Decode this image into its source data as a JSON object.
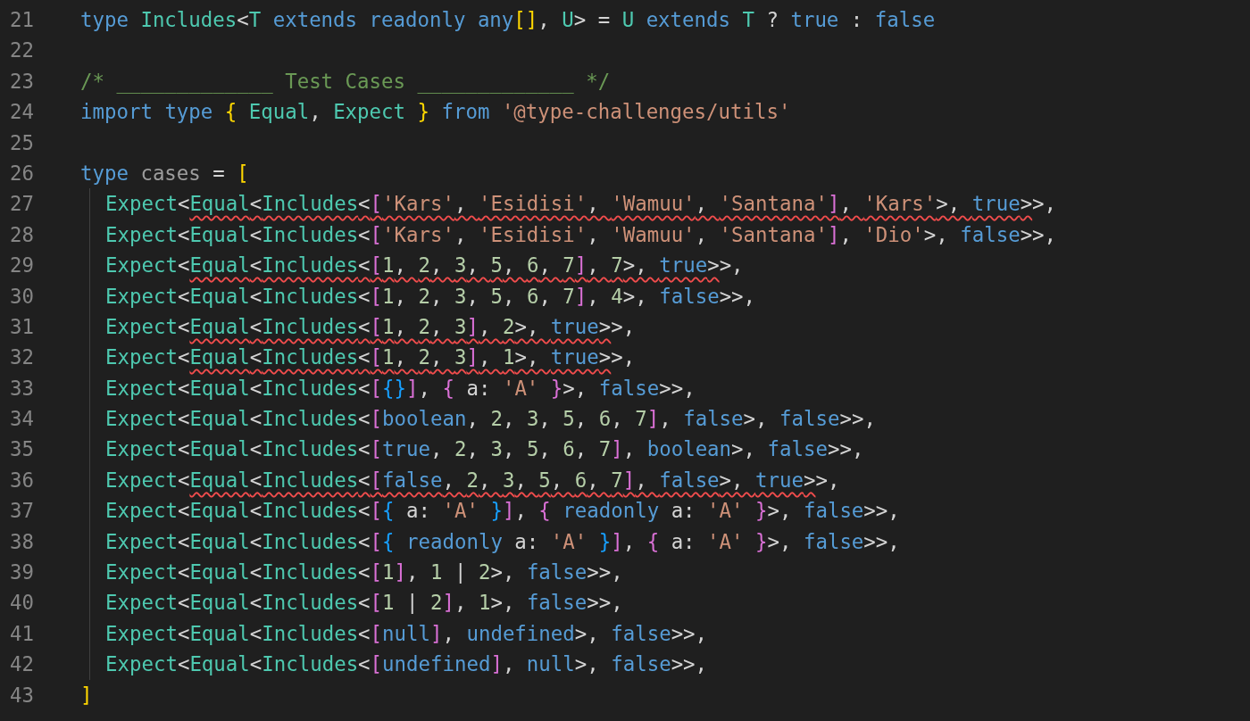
{
  "lines": [
    {
      "number": "21",
      "indented": false,
      "segments": [
        {
          "error": false,
          "tokens": [
            {
              "text": "type ",
              "kind": "keyword"
            },
            {
              "text": "Includes",
              "kind": "type"
            },
            {
              "text": "<",
              "kind": "punct"
            },
            {
              "text": "T ",
              "kind": "type"
            },
            {
              "text": "extends ",
              "kind": "keyword"
            },
            {
              "text": "readonly ",
              "kind": "keyword"
            },
            {
              "text": "any",
              "kind": "keyword"
            },
            {
              "text": "[]",
              "kind": "bracket1"
            },
            {
              "text": ", ",
              "kind": "punct"
            },
            {
              "text": "U",
              "kind": "type"
            },
            {
              "text": "> = ",
              "kind": "punct"
            },
            {
              "text": "U ",
              "kind": "type"
            },
            {
              "text": "extends ",
              "kind": "keyword"
            },
            {
              "text": "T",
              "kind": "type"
            },
            {
              "text": " ? ",
              "kind": "punct"
            },
            {
              "text": "true",
              "kind": "keyword"
            },
            {
              "text": " : ",
              "kind": "punct"
            },
            {
              "text": "false",
              "kind": "keyword"
            }
          ]
        }
      ]
    },
    {
      "number": "22",
      "indented": false
    },
    {
      "number": "23",
      "indented": false,
      "segments": [
        {
          "error": false,
          "tokens": [
            {
              "text": "/* _____________ Test Cases _____________ */",
              "kind": "comment"
            }
          ]
        }
      ]
    },
    {
      "number": "24",
      "indented": false,
      "segments": [
        {
          "error": false,
          "tokens": [
            {
              "text": "import ",
              "kind": "keyword"
            },
            {
              "text": "type ",
              "kind": "keyword"
            },
            {
              "text": "{ ",
              "kind": "bracket1"
            },
            {
              "text": "Equal",
              "kind": "type"
            },
            {
              "text": ", ",
              "kind": "punct"
            },
            {
              "text": "Expect ",
              "kind": "type"
            },
            {
              "text": "} ",
              "kind": "bracket1"
            },
            {
              "text": "from ",
              "kind": "keyword"
            },
            {
              "text": "'@type-challenges/utils'",
              "kind": "string"
            }
          ]
        }
      ]
    },
    {
      "number": "25",
      "indented": false
    },
    {
      "number": "26",
      "indented": false,
      "segments": [
        {
          "error": false,
          "tokens": [
            {
              "text": "type ",
              "kind": "keyword"
            },
            {
              "text": "cases",
              "kind": "variable"
            },
            {
              "text": " = ",
              "kind": "punct"
            },
            {
              "text": "[",
              "kind": "bracket1"
            }
          ]
        }
      ]
    },
    {
      "number": "27",
      "indented": true,
      "segments": [
        {
          "error": false,
          "tokens": [
            {
              "text": "Expect",
              "kind": "type"
            },
            {
              "text": "<",
              "kind": "punct"
            }
          ]
        },
        {
          "error": true,
          "tokens": [
            {
              "text": "Equal",
              "kind": "type"
            },
            {
              "text": "<",
              "kind": "punct"
            },
            {
              "text": "Includes",
              "kind": "type"
            },
            {
              "text": "<",
              "kind": "punct"
            },
            {
              "text": "[",
              "kind": "bracket2"
            },
            {
              "text": "'Kars'",
              "kind": "string"
            },
            {
              "text": ", ",
              "kind": "punct"
            },
            {
              "text": "'Esidisi'",
              "kind": "string"
            },
            {
              "text": ", ",
              "kind": "punct"
            },
            {
              "text": "'Wamuu'",
              "kind": "string"
            },
            {
              "text": ", ",
              "kind": "punct"
            },
            {
              "text": "'Santana'",
              "kind": "string"
            },
            {
              "text": "]",
              "kind": "bracket2"
            },
            {
              "text": ", ",
              "kind": "punct"
            },
            {
              "text": "'Kars'",
              "kind": "string"
            },
            {
              "text": ">, ",
              "kind": "punct"
            },
            {
              "text": "true",
              "kind": "keyword"
            },
            {
              "text": ">",
              "kind": "punct"
            }
          ]
        },
        {
          "error": false,
          "tokens": [
            {
              "text": ">,",
              "kind": "punct"
            }
          ]
        }
      ]
    },
    {
      "number": "28",
      "indented": true,
      "segments": [
        {
          "error": false,
          "tokens": [
            {
              "text": "Expect",
              "kind": "type"
            },
            {
              "text": "<",
              "kind": "punct"
            },
            {
              "text": "Equal",
              "kind": "type"
            },
            {
              "text": "<",
              "kind": "punct"
            },
            {
              "text": "Includes",
              "kind": "type"
            },
            {
              "text": "<",
              "kind": "punct"
            },
            {
              "text": "[",
              "kind": "bracket2"
            },
            {
              "text": "'Kars'",
              "kind": "string"
            },
            {
              "text": ", ",
              "kind": "punct"
            },
            {
              "text": "'Esidisi'",
              "kind": "string"
            },
            {
              "text": ", ",
              "kind": "punct"
            },
            {
              "text": "'Wamuu'",
              "kind": "string"
            },
            {
              "text": ", ",
              "kind": "punct"
            },
            {
              "text": "'Santana'",
              "kind": "string"
            },
            {
              "text": "]",
              "kind": "bracket2"
            },
            {
              "text": ", ",
              "kind": "punct"
            },
            {
              "text": "'Dio'",
              "kind": "string"
            },
            {
              "text": ">, ",
              "kind": "punct"
            },
            {
              "text": "false",
              "kind": "keyword"
            },
            {
              "text": ">>,",
              "kind": "punct"
            }
          ]
        }
      ]
    },
    {
      "number": "29",
      "indented": true,
      "segments": [
        {
          "error": false,
          "tokens": [
            {
              "text": "Expect",
              "kind": "type"
            },
            {
              "text": "<",
              "kind": "punct"
            }
          ]
        },
        {
          "error": true,
          "tokens": [
            {
              "text": "Equal",
              "kind": "type"
            },
            {
              "text": "<",
              "kind": "punct"
            },
            {
              "text": "Includes",
              "kind": "type"
            },
            {
              "text": "<",
              "kind": "punct"
            },
            {
              "text": "[",
              "kind": "bracket2"
            },
            {
              "text": "1",
              "kind": "number"
            },
            {
              "text": ", ",
              "kind": "punct"
            },
            {
              "text": "2",
              "kind": "number"
            },
            {
              "text": ", ",
              "kind": "punct"
            },
            {
              "text": "3",
              "kind": "number"
            },
            {
              "text": ", ",
              "kind": "punct"
            },
            {
              "text": "5",
              "kind": "number"
            },
            {
              "text": ", ",
              "kind": "punct"
            },
            {
              "text": "6",
              "kind": "number"
            },
            {
              "text": ", ",
              "kind": "punct"
            },
            {
              "text": "7",
              "kind": "number"
            },
            {
              "text": "]",
              "kind": "bracket2"
            },
            {
              "text": ", ",
              "kind": "punct"
            },
            {
              "text": "7",
              "kind": "number"
            },
            {
              "text": ">, ",
              "kind": "punct"
            },
            {
              "text": "true",
              "kind": "keyword"
            },
            {
              "text": ">",
              "kind": "punct"
            }
          ]
        },
        {
          "error": false,
          "tokens": [
            {
              "text": ">,",
              "kind": "punct"
            }
          ]
        }
      ]
    },
    {
      "number": "30",
      "indented": true,
      "segments": [
        {
          "error": false,
          "tokens": [
            {
              "text": "Expect",
              "kind": "type"
            },
            {
              "text": "<",
              "kind": "punct"
            },
            {
              "text": "Equal",
              "kind": "type"
            },
            {
              "text": "<",
              "kind": "punct"
            },
            {
              "text": "Includes",
              "kind": "type"
            },
            {
              "text": "<",
              "kind": "punct"
            },
            {
              "text": "[",
              "kind": "bracket2"
            },
            {
              "text": "1",
              "kind": "number"
            },
            {
              "text": ", ",
              "kind": "punct"
            },
            {
              "text": "2",
              "kind": "number"
            },
            {
              "text": ", ",
              "kind": "punct"
            },
            {
              "text": "3",
              "kind": "number"
            },
            {
              "text": ", ",
              "kind": "punct"
            },
            {
              "text": "5",
              "kind": "number"
            },
            {
              "text": ", ",
              "kind": "punct"
            },
            {
              "text": "6",
              "kind": "number"
            },
            {
              "text": ", ",
              "kind": "punct"
            },
            {
              "text": "7",
              "kind": "number"
            },
            {
              "text": "]",
              "kind": "bracket2"
            },
            {
              "text": ", ",
              "kind": "punct"
            },
            {
              "text": "4",
              "kind": "number"
            },
            {
              "text": ">, ",
              "kind": "punct"
            },
            {
              "text": "false",
              "kind": "keyword"
            },
            {
              "text": ">>,",
              "kind": "punct"
            }
          ]
        }
      ]
    },
    {
      "number": "31",
      "indented": true,
      "segments": [
        {
          "error": false,
          "tokens": [
            {
              "text": "Expect",
              "kind": "type"
            },
            {
              "text": "<",
              "kind": "punct"
            }
          ]
        },
        {
          "error": true,
          "tokens": [
            {
              "text": "Equal",
              "kind": "type"
            },
            {
              "text": "<",
              "kind": "punct"
            },
            {
              "text": "Includes",
              "kind": "type"
            },
            {
              "text": "<",
              "kind": "punct"
            },
            {
              "text": "[",
              "kind": "bracket2"
            },
            {
              "text": "1",
              "kind": "number"
            },
            {
              "text": ", ",
              "kind": "punct"
            },
            {
              "text": "2",
              "kind": "number"
            },
            {
              "text": ", ",
              "kind": "punct"
            },
            {
              "text": "3",
              "kind": "number"
            },
            {
              "text": "]",
              "kind": "bracket2"
            },
            {
              "text": ", ",
              "kind": "punct"
            },
            {
              "text": "2",
              "kind": "number"
            },
            {
              "text": ">, ",
              "kind": "punct"
            },
            {
              "text": "true",
              "kind": "keyword"
            },
            {
              "text": ">",
              "kind": "punct"
            }
          ]
        },
        {
          "error": false,
          "tokens": [
            {
              "text": ">,",
              "kind": "punct"
            }
          ]
        }
      ]
    },
    {
      "number": "32",
      "indented": true,
      "segments": [
        {
          "error": false,
          "tokens": [
            {
              "text": "Expect",
              "kind": "type"
            },
            {
              "text": "<",
              "kind": "punct"
            }
          ]
        },
        {
          "error": true,
          "tokens": [
            {
              "text": "Equal",
              "kind": "type"
            },
            {
              "text": "<",
              "kind": "punct"
            },
            {
              "text": "Includes",
              "kind": "type"
            },
            {
              "text": "<",
              "kind": "punct"
            },
            {
              "text": "[",
              "kind": "bracket2"
            },
            {
              "text": "1",
              "kind": "number"
            },
            {
              "text": ", ",
              "kind": "punct"
            },
            {
              "text": "2",
              "kind": "number"
            },
            {
              "text": ", ",
              "kind": "punct"
            },
            {
              "text": "3",
              "kind": "number"
            },
            {
              "text": "]",
              "kind": "bracket2"
            },
            {
              "text": ", ",
              "kind": "punct"
            },
            {
              "text": "1",
              "kind": "number"
            },
            {
              "text": ">, ",
              "kind": "punct"
            },
            {
              "text": "true",
              "kind": "keyword"
            },
            {
              "text": ">",
              "kind": "punct"
            }
          ]
        },
        {
          "error": false,
          "tokens": [
            {
              "text": ">,",
              "kind": "punct"
            }
          ]
        }
      ]
    },
    {
      "number": "33",
      "indented": true,
      "segments": [
        {
          "error": false,
          "tokens": [
            {
              "text": "Expect",
              "kind": "type"
            },
            {
              "text": "<",
              "kind": "punct"
            },
            {
              "text": "Equal",
              "kind": "type"
            },
            {
              "text": "<",
              "kind": "punct"
            },
            {
              "text": "Includes",
              "kind": "type"
            },
            {
              "text": "<",
              "kind": "punct"
            },
            {
              "text": "[",
              "kind": "bracket2"
            },
            {
              "text": "{}",
              "kind": "bracket3"
            },
            {
              "text": "]",
              "kind": "bracket2"
            },
            {
              "text": ", ",
              "kind": "punct"
            },
            {
              "text": "{",
              "kind": "bracket2"
            },
            {
              "text": " a: ",
              "kind": "punct"
            },
            {
              "text": "'A' ",
              "kind": "string"
            },
            {
              "text": "}",
              "kind": "bracket2"
            },
            {
              "text": ">, ",
              "kind": "punct"
            },
            {
              "text": "false",
              "kind": "keyword"
            },
            {
              "text": ">>,",
              "kind": "punct"
            }
          ]
        }
      ]
    },
    {
      "number": "34",
      "indented": true,
      "segments": [
        {
          "error": false,
          "tokens": [
            {
              "text": "Expect",
              "kind": "type"
            },
            {
              "text": "<",
              "kind": "punct"
            },
            {
              "text": "Equal",
              "kind": "type"
            },
            {
              "text": "<",
              "kind": "punct"
            },
            {
              "text": "Includes",
              "kind": "type"
            },
            {
              "text": "<",
              "kind": "punct"
            },
            {
              "text": "[",
              "kind": "bracket2"
            },
            {
              "text": "boolean",
              "kind": "keyword"
            },
            {
              "text": ", ",
              "kind": "punct"
            },
            {
              "text": "2",
              "kind": "number"
            },
            {
              "text": ", ",
              "kind": "punct"
            },
            {
              "text": "3",
              "kind": "number"
            },
            {
              "text": ", ",
              "kind": "punct"
            },
            {
              "text": "5",
              "kind": "number"
            },
            {
              "text": ", ",
              "kind": "punct"
            },
            {
              "text": "6",
              "kind": "number"
            },
            {
              "text": ", ",
              "kind": "punct"
            },
            {
              "text": "7",
              "kind": "number"
            },
            {
              "text": "]",
              "kind": "bracket2"
            },
            {
              "text": ", ",
              "kind": "punct"
            },
            {
              "text": "false",
              "kind": "keyword"
            },
            {
              "text": ">, ",
              "kind": "punct"
            },
            {
              "text": "false",
              "kind": "keyword"
            },
            {
              "text": ">>,",
              "kind": "punct"
            }
          ]
        }
      ]
    },
    {
      "number": "35",
      "indented": true,
      "segments": [
        {
          "error": false,
          "tokens": [
            {
              "text": "Expect",
              "kind": "type"
            },
            {
              "text": "<",
              "kind": "punct"
            },
            {
              "text": "Equal",
              "kind": "type"
            },
            {
              "text": "<",
              "kind": "punct"
            },
            {
              "text": "Includes",
              "kind": "type"
            },
            {
              "text": "<",
              "kind": "punct"
            },
            {
              "text": "[",
              "kind": "bracket2"
            },
            {
              "text": "true",
              "kind": "keyword"
            },
            {
              "text": ", ",
              "kind": "punct"
            },
            {
              "text": "2",
              "kind": "number"
            },
            {
              "text": ", ",
              "kind": "punct"
            },
            {
              "text": "3",
              "kind": "number"
            },
            {
              "text": ", ",
              "kind": "punct"
            },
            {
              "text": "5",
              "kind": "number"
            },
            {
              "text": ", ",
              "kind": "punct"
            },
            {
              "text": "6",
              "kind": "number"
            },
            {
              "text": ", ",
              "kind": "punct"
            },
            {
              "text": "7",
              "kind": "number"
            },
            {
              "text": "]",
              "kind": "bracket2"
            },
            {
              "text": ", ",
              "kind": "punct"
            },
            {
              "text": "boolean",
              "kind": "keyword"
            },
            {
              "text": ">, ",
              "kind": "punct"
            },
            {
              "text": "false",
              "kind": "keyword"
            },
            {
              "text": ">>,",
              "kind": "punct"
            }
          ]
        }
      ]
    },
    {
      "number": "36",
      "indented": true,
      "segments": [
        {
          "error": false,
          "tokens": [
            {
              "text": "Expect",
              "kind": "type"
            },
            {
              "text": "<",
              "kind": "punct"
            }
          ]
        },
        {
          "error": true,
          "tokens": [
            {
              "text": "Equal",
              "kind": "type"
            },
            {
              "text": "<",
              "kind": "punct"
            },
            {
              "text": "Includes",
              "kind": "type"
            },
            {
              "text": "<",
              "kind": "punct"
            },
            {
              "text": "[",
              "kind": "bracket2"
            },
            {
              "text": "false",
              "kind": "keyword"
            },
            {
              "text": ", ",
              "kind": "punct"
            },
            {
              "text": "2",
              "kind": "number"
            },
            {
              "text": ", ",
              "kind": "punct"
            },
            {
              "text": "3",
              "kind": "number"
            },
            {
              "text": ", ",
              "kind": "punct"
            },
            {
              "text": "5",
              "kind": "number"
            },
            {
              "text": ", ",
              "kind": "punct"
            },
            {
              "text": "6",
              "kind": "number"
            },
            {
              "text": ", ",
              "kind": "punct"
            },
            {
              "text": "7",
              "kind": "number"
            },
            {
              "text": "]",
              "kind": "bracket2"
            },
            {
              "text": ", ",
              "kind": "punct"
            },
            {
              "text": "false",
              "kind": "keyword"
            },
            {
              "text": ">, ",
              "kind": "punct"
            },
            {
              "text": "true",
              "kind": "keyword"
            },
            {
              "text": ">",
              "kind": "punct"
            }
          ]
        },
        {
          "error": false,
          "tokens": [
            {
              "text": ">,",
              "kind": "punct"
            }
          ]
        }
      ]
    },
    {
      "number": "37",
      "indented": true,
      "segments": [
        {
          "error": false,
          "tokens": [
            {
              "text": "Expect",
              "kind": "type"
            },
            {
              "text": "<",
              "kind": "punct"
            },
            {
              "text": "Equal",
              "kind": "type"
            },
            {
              "text": "<",
              "kind": "punct"
            },
            {
              "text": "Includes",
              "kind": "type"
            },
            {
              "text": "<",
              "kind": "punct"
            },
            {
              "text": "[",
              "kind": "bracket2"
            },
            {
              "text": "{",
              "kind": "bracket3"
            },
            {
              "text": " a: ",
              "kind": "punct"
            },
            {
              "text": "'A' ",
              "kind": "string"
            },
            {
              "text": "}",
              "kind": "bracket3"
            },
            {
              "text": "]",
              "kind": "bracket2"
            },
            {
              "text": ", ",
              "kind": "punct"
            },
            {
              "text": "{ ",
              "kind": "bracket2"
            },
            {
              "text": "readonly",
              "kind": "keyword"
            },
            {
              "text": " a: ",
              "kind": "punct"
            },
            {
              "text": "'A' ",
              "kind": "string"
            },
            {
              "text": "}",
              "kind": "bracket2"
            },
            {
              "text": ">, ",
              "kind": "punct"
            },
            {
              "text": "false",
              "kind": "keyword"
            },
            {
              "text": ">>,",
              "kind": "punct"
            }
          ]
        }
      ]
    },
    {
      "number": "38",
      "indented": true,
      "segments": [
        {
          "error": false,
          "tokens": [
            {
              "text": "Expect",
              "kind": "type"
            },
            {
              "text": "<",
              "kind": "punct"
            },
            {
              "text": "Equal",
              "kind": "type"
            },
            {
              "text": "<",
              "kind": "punct"
            },
            {
              "text": "Includes",
              "kind": "type"
            },
            {
              "text": "<",
              "kind": "punct"
            },
            {
              "text": "[",
              "kind": "bracket2"
            },
            {
              "text": "{ ",
              "kind": "bracket3"
            },
            {
              "text": "readonly",
              "kind": "keyword"
            },
            {
              "text": " a: ",
              "kind": "punct"
            },
            {
              "text": "'A' ",
              "kind": "string"
            },
            {
              "text": "}",
              "kind": "bracket3"
            },
            {
              "text": "]",
              "kind": "bracket2"
            },
            {
              "text": ", ",
              "kind": "punct"
            },
            {
              "text": "{",
              "kind": "bracket2"
            },
            {
              "text": " a: ",
              "kind": "punct"
            },
            {
              "text": "'A' ",
              "kind": "string"
            },
            {
              "text": "}",
              "kind": "bracket2"
            },
            {
              "text": ">, ",
              "kind": "punct"
            },
            {
              "text": "false",
              "kind": "keyword"
            },
            {
              "text": ">>,",
              "kind": "punct"
            }
          ]
        }
      ]
    },
    {
      "number": "39",
      "indented": true,
      "segments": [
        {
          "error": false,
          "tokens": [
            {
              "text": "Expect",
              "kind": "type"
            },
            {
              "text": "<",
              "kind": "punct"
            },
            {
              "text": "Equal",
              "kind": "type"
            },
            {
              "text": "<",
              "kind": "punct"
            },
            {
              "text": "Includes",
              "kind": "type"
            },
            {
              "text": "<",
              "kind": "punct"
            },
            {
              "text": "[",
              "kind": "bracket2"
            },
            {
              "text": "1",
              "kind": "number"
            },
            {
              "text": "]",
              "kind": "bracket2"
            },
            {
              "text": ", ",
              "kind": "punct"
            },
            {
              "text": "1",
              "kind": "number"
            },
            {
              "text": " | ",
              "kind": "punct"
            },
            {
              "text": "2",
              "kind": "number"
            },
            {
              "text": ">, ",
              "kind": "punct"
            },
            {
              "text": "false",
              "kind": "keyword"
            },
            {
              "text": ">>,",
              "kind": "punct"
            }
          ]
        }
      ]
    },
    {
      "number": "40",
      "indented": true,
      "segments": [
        {
          "error": false,
          "tokens": [
            {
              "text": "Expect",
              "kind": "type"
            },
            {
              "text": "<",
              "kind": "punct"
            },
            {
              "text": "Equal",
              "kind": "type"
            },
            {
              "text": "<",
              "kind": "punct"
            },
            {
              "text": "Includes",
              "kind": "type"
            },
            {
              "text": "<",
              "kind": "punct"
            },
            {
              "text": "[",
              "kind": "bracket2"
            },
            {
              "text": "1",
              "kind": "number"
            },
            {
              "text": " | ",
              "kind": "punct"
            },
            {
              "text": "2",
              "kind": "number"
            },
            {
              "text": "]",
              "kind": "bracket2"
            },
            {
              "text": ", ",
              "kind": "punct"
            },
            {
              "text": "1",
              "kind": "number"
            },
            {
              "text": ">, ",
              "kind": "punct"
            },
            {
              "text": "false",
              "kind": "keyword"
            },
            {
              "text": ">>,",
              "kind": "punct"
            }
          ]
        }
      ]
    },
    {
      "number": "41",
      "indented": true,
      "segments": [
        {
          "error": false,
          "tokens": [
            {
              "text": "Expect",
              "kind": "type"
            },
            {
              "text": "<",
              "kind": "punct"
            },
            {
              "text": "Equal",
              "kind": "type"
            },
            {
              "text": "<",
              "kind": "punct"
            },
            {
              "text": "Includes",
              "kind": "type"
            },
            {
              "text": "<",
              "kind": "punct"
            },
            {
              "text": "[",
              "kind": "bracket2"
            },
            {
              "text": "null",
              "kind": "keyword"
            },
            {
              "text": "]",
              "kind": "bracket2"
            },
            {
              "text": ", ",
              "kind": "punct"
            },
            {
              "text": "undefined",
              "kind": "keyword"
            },
            {
              "text": ">, ",
              "kind": "punct"
            },
            {
              "text": "false",
              "kind": "keyword"
            },
            {
              "text": ">>,",
              "kind": "punct"
            }
          ]
        }
      ]
    },
    {
      "number": "42",
      "indented": true,
      "segments": [
        {
          "error": false,
          "tokens": [
            {
              "text": "Expect",
              "kind": "type"
            },
            {
              "text": "<",
              "kind": "punct"
            },
            {
              "text": "Equal",
              "kind": "type"
            },
            {
              "text": "<",
              "kind": "punct"
            },
            {
              "text": "Includes",
              "kind": "type"
            },
            {
              "text": "<",
              "kind": "punct"
            },
            {
              "text": "[",
              "kind": "bracket2"
            },
            {
              "text": "undefined",
              "kind": "keyword"
            },
            {
              "text": "]",
              "kind": "bracket2"
            },
            {
              "text": ", ",
              "kind": "punct"
            },
            {
              "text": "null",
              "kind": "keyword"
            },
            {
              "text": ">, ",
              "kind": "punct"
            },
            {
              "text": "false",
              "kind": "keyword"
            },
            {
              "text": ">>,",
              "kind": "punct"
            }
          ]
        }
      ]
    },
    {
      "number": "43",
      "indented": false,
      "segments": [
        {
          "error": false,
          "tokens": [
            {
              "text": "]",
              "kind": "bracket1"
            }
          ]
        }
      ]
    }
  ]
}
